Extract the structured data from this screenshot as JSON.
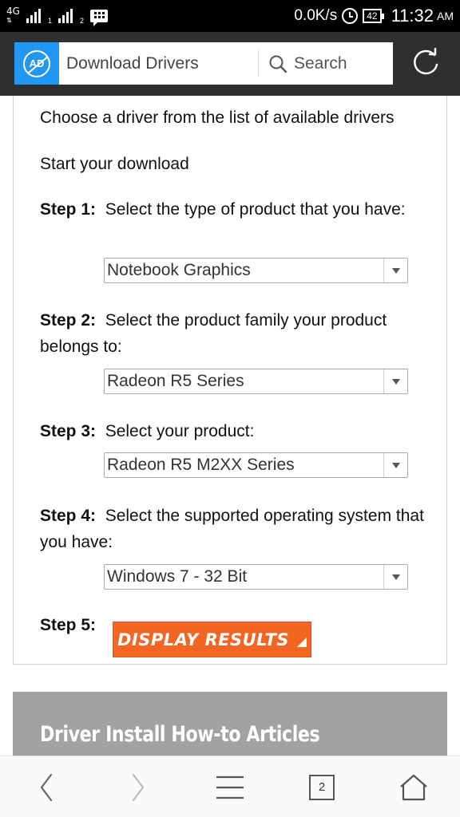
{
  "status_bar": {
    "network": "4G",
    "sim1": "1",
    "sim2": "2",
    "speed": "0.0K/s",
    "battery": "42",
    "time": "11:32",
    "ampm": "AM"
  },
  "header": {
    "logo_text": "AD",
    "title": "Download Drivers",
    "search_label": "Search",
    "brand_color": "#2196f3"
  },
  "content": {
    "intro": "Choose a driver from the list of available drivers",
    "start": "Start your download",
    "steps": [
      {
        "label": "Step 1:",
        "text": "Select the type of product that you have:",
        "selected": "Notebook Graphics"
      },
      {
        "label": "Step 2:",
        "text": "Select the product family your product belongs to:",
        "selected": "Radeon R5 Series"
      },
      {
        "label": "Step 3:",
        "text": "Select your product:",
        "selected": "Radeon R5 M2XX Series"
      },
      {
        "label": "Step 4:",
        "text": "Select the supported operating system that you have:",
        "selected": "Windows 7 - 32 Bit"
      }
    ],
    "step5_label": "Step 5:",
    "display_button": "DISPLAY RESULTS",
    "button_color": "#f26522"
  },
  "articles": {
    "title": "Driver Install How-to Articles"
  },
  "bottom_nav": {
    "tab_count": "2",
    "icons": [
      "back-icon",
      "forward-icon",
      "menu-icon",
      "tabs-icon",
      "home-icon"
    ]
  }
}
